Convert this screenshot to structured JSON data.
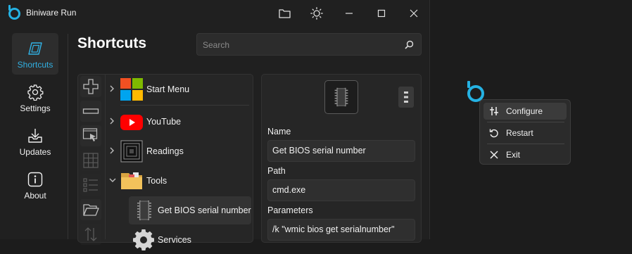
{
  "window": {
    "title": "Biniware Run",
    "controls": {
      "folder_icon": "folder-icon",
      "theme_icon": "brightness-icon",
      "minimize_icon": "minimize-icon",
      "maximize_icon": "maximize-icon",
      "close_icon": "close-icon"
    }
  },
  "nav": {
    "items": [
      {
        "label": "Shortcuts",
        "icon": "shortcut-parallelogram-icon",
        "active": true
      },
      {
        "label": "Settings",
        "icon": "gear-icon",
        "active": false
      },
      {
        "label": "Updates",
        "icon": "download-tray-icon",
        "active": false
      },
      {
        "label": "About",
        "icon": "info-icon",
        "active": false
      }
    ]
  },
  "main": {
    "title": "Shortcuts",
    "search": {
      "placeholder": "Search",
      "value": "",
      "icon": "search-icon"
    }
  },
  "toolbar": {
    "buttons": [
      {
        "icon": "add-icon",
        "enabled": true
      },
      {
        "icon": "remove-icon",
        "enabled": true
      },
      {
        "icon": "pick-window-icon",
        "enabled": true
      },
      {
        "icon": "grid-icon",
        "enabled": false
      },
      {
        "icon": "list-icon",
        "enabled": false
      },
      {
        "icon": "open-folder-icon",
        "enabled": true
      },
      {
        "icon": "sort-icon",
        "enabled": false
      }
    ]
  },
  "tree": {
    "items": [
      {
        "label": "Start Menu",
        "icon": "windows-logo-icon",
        "expanded": false
      },
      {
        "label": "YouTube",
        "icon": "youtube-icon",
        "expanded": false
      },
      {
        "label": "Readings",
        "icon": "stack-icon",
        "expanded": false
      },
      {
        "label": "Tools",
        "icon": "folder-icon",
        "expanded": true,
        "children": [
          {
            "label": "Get BIOS serial number",
            "icon": "chip-icon",
            "selected": true
          },
          {
            "label": "Services",
            "icon": "gear-icon",
            "selected": false
          }
        ]
      }
    ]
  },
  "details": {
    "icon": "chip-icon",
    "more_icon": "more-vertical-icon",
    "fields": [
      {
        "label": "Name",
        "value": "Get BIOS serial number"
      },
      {
        "label": "Path",
        "value": "cmd.exe"
      },
      {
        "label": "Parameters",
        "value": "/k \"wmic bios get serialnumber\""
      }
    ]
  },
  "tray": {
    "icon": "biniware-logo-icon",
    "menu": [
      {
        "label": "Configure",
        "icon": "sliders-icon",
        "highlighted": true
      },
      {
        "label": "Restart",
        "icon": "restart-icon",
        "highlighted": false
      },
      {
        "label": "Exit",
        "icon": "close-icon",
        "highlighted": false
      }
    ]
  },
  "colors": {
    "accent": "#25b2e3",
    "window_bg": "#202020",
    "desktop_bg": "#1c1c1c",
    "youtube_red": "#ff0000"
  }
}
